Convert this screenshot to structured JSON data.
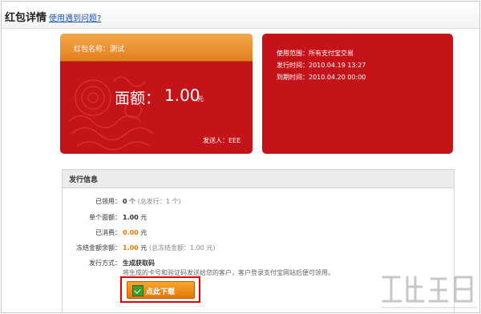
{
  "header": {
    "title": "红包详情",
    "help_link": "使用遇到问题?"
  },
  "envelope": {
    "name_text": "红包名称：测试",
    "amount_label": "面额：",
    "amount": "1.00",
    "unit": "元",
    "sender_text": "发送人：EEE"
  },
  "details": {
    "scope": "使用范围：所有支付宝交易",
    "issue_time": "发行时间：2010.04.19 13:27",
    "expire_time": "到期时间：2010.04.20 00:00"
  },
  "issue_panel": {
    "title": "发行信息",
    "claimed_label": "已领用：",
    "claimed_value": "0",
    "claimed_unit": "个",
    "claimed_note": "(总发行：1 个)",
    "single_label": "单个面额：",
    "single_value": "1.00",
    "single_unit": "元",
    "consumed_label": "已消费：",
    "consumed_value": "0.00",
    "consumed_unit": "元",
    "frozen_label": "冻结金额余额：",
    "frozen_value": "1.00",
    "frozen_unit": "元",
    "frozen_note": "(总冻结金额：1.00 元)",
    "method_label": "发行方式：",
    "method_value": "生成获取码",
    "description": "将生成的卡号和验证码发送给您的客户，客户登录支付宝网站后便可领用。",
    "download_button": "点此下载"
  },
  "colors": {
    "envelope_red": "#c4141a",
    "band_orange": "#e47f1e",
    "highlight_red": "#e00000",
    "value_orange": "#ee7a0b",
    "link_blue": "#1a58b0"
  },
  "icons": [
    "envelope-pattern-icon",
    "download-icon",
    "watermark-logo"
  ]
}
